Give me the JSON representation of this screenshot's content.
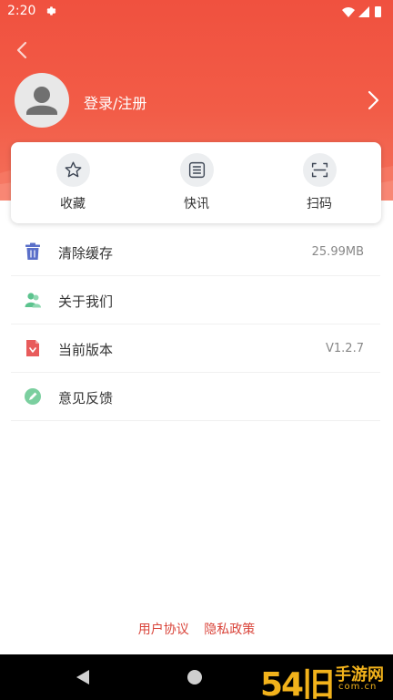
{
  "status_bar": {
    "time": "2:20"
  },
  "header": {
    "login_label": "登录/注册"
  },
  "quick_actions": [
    {
      "label": "收藏",
      "icon": "star-icon"
    },
    {
      "label": "快讯",
      "icon": "news-list-icon"
    },
    {
      "label": "扫码",
      "icon": "scan-icon"
    }
  ],
  "menu": [
    {
      "label": "清除缓存",
      "value": "25.99MB",
      "icon": "trash-icon"
    },
    {
      "label": "关于我们",
      "value": "",
      "icon": "people-icon"
    },
    {
      "label": "当前版本",
      "value": "V1.2.7",
      "icon": "version-file-icon"
    },
    {
      "label": "意见反馈",
      "value": "",
      "icon": "feedback-pencil-icon"
    }
  ],
  "footer": {
    "user_agreement": "用户协议",
    "privacy_policy": "隐私政策"
  },
  "watermark": {
    "digits": "54旧",
    "name": "手游网",
    "domain": "com.cn"
  },
  "colors": {
    "header_red": "#f0513f",
    "footer_link_red": "#d9443a",
    "trash_blue": "#5a6fc9",
    "people_green": "#5cc38e",
    "version_red": "#e85b5b"
  }
}
